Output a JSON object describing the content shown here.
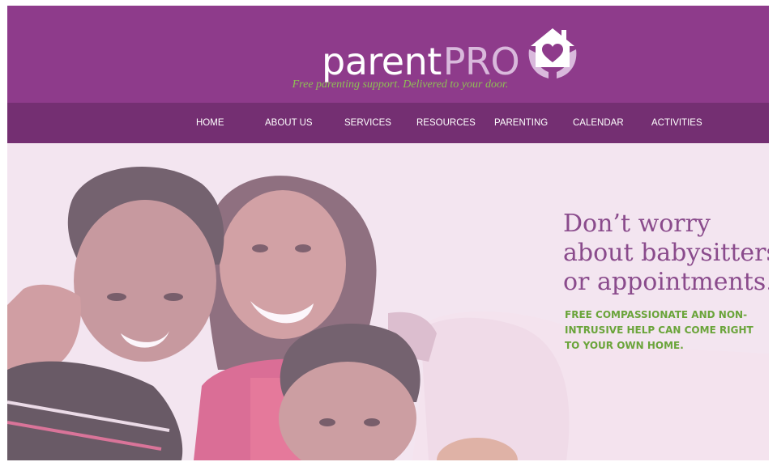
{
  "header": {
    "logo_parent": "parent",
    "logo_pro": "PRO",
    "logo_icon": "house-heart-hands-icon",
    "tagline": "Free parenting support. Delivered to your door."
  },
  "nav": {
    "items": [
      {
        "label": "HOME"
      },
      {
        "label": "ABOUT US"
      },
      {
        "label": "SERVICES"
      },
      {
        "label": "RESOURCES"
      },
      {
        "label": "PARENTING"
      },
      {
        "label": "CALENDAR"
      },
      {
        "label": "ACTIVITIES"
      }
    ]
  },
  "hero": {
    "photo": "family-photo-mother-and-two-sons",
    "headline_lines": [
      "Don’t worry",
      "about babysitters",
      "or appointments."
    ],
    "subline_lines": [
      "FREE COMPASSIONATE AND NON-",
      "INTRUSIVE HELP CAN COME RIGHT",
      "TO YOUR OWN HOME."
    ]
  },
  "colors": {
    "header_bg": "#8e3b8b",
    "nav_bg": "#742f72",
    "tagline": "#8fbf55",
    "headline": "#8a4b8c",
    "subline": "#6aa43a"
  }
}
